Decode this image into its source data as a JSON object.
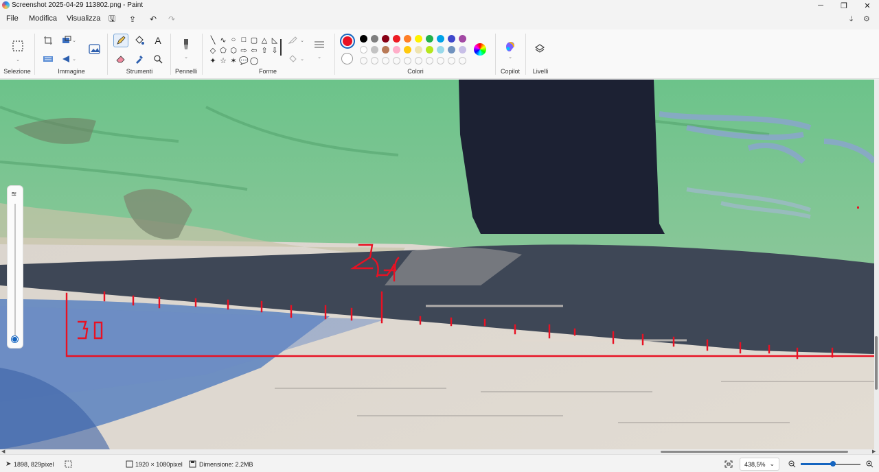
{
  "window": {
    "title": "Screenshot 2025-04-29 113802.png - Paint",
    "minimize": "─",
    "restore": "❐",
    "close": "✕"
  },
  "menu": {
    "file": "File",
    "edit": "Modifica",
    "view": "Visualizza"
  },
  "quick_access": {
    "save_icon": "🖫",
    "share_icon": "⇪",
    "undo_icon": "↶",
    "redo_icon": "↷"
  },
  "menu_right": {
    "account_icon": "⇣",
    "settings_icon": "⚙"
  },
  "ribbon": {
    "groups": {
      "selection": "Selezione",
      "image": "Immagine",
      "tools": "Strumenti",
      "brushes": "Pennelli",
      "shapes": "Forme",
      "colors": "Colori",
      "copilot": "Copilot",
      "layers": "Livelli"
    },
    "shape_glyphs": [
      "╲",
      "∿",
      "○",
      "□",
      "▢",
      "△",
      "◺",
      "◇",
      "⬠",
      "⬡",
      "⇨",
      "⇦",
      "⇧",
      "⇩",
      "✦",
      "☆",
      "✶",
      "💬",
      "◯"
    ],
    "primary_color": "#e81123",
    "secondary_color": "#ffffff",
    "palette_row1": [
      "#000000",
      "#7f7f7f",
      "#880015",
      "#ed1c24",
      "#ff7f27",
      "#fff200",
      "#22b14c",
      "#00a2e8",
      "#3f48cc",
      "#a349a4"
    ],
    "palette_row2": [
      "#ffffff",
      "#c3c3c3",
      "#b97a57",
      "#ffaec9",
      "#ffc90e",
      "#efe4b0",
      "#b5e61d",
      "#99d9ea",
      "#7092be",
      "#c8bfe7"
    ]
  },
  "canvas": {
    "annotation_30": "30",
    "annotation_2": "2",
    "stroke_color": "#e81123"
  },
  "status": {
    "cursor_pos": "1898, 829pixel",
    "canvas_size": "1920 × 1080pixel",
    "file_size": "Dimensione: 2.2MB",
    "zoom": "438,5%",
    "zoom_level": 0.54
  }
}
